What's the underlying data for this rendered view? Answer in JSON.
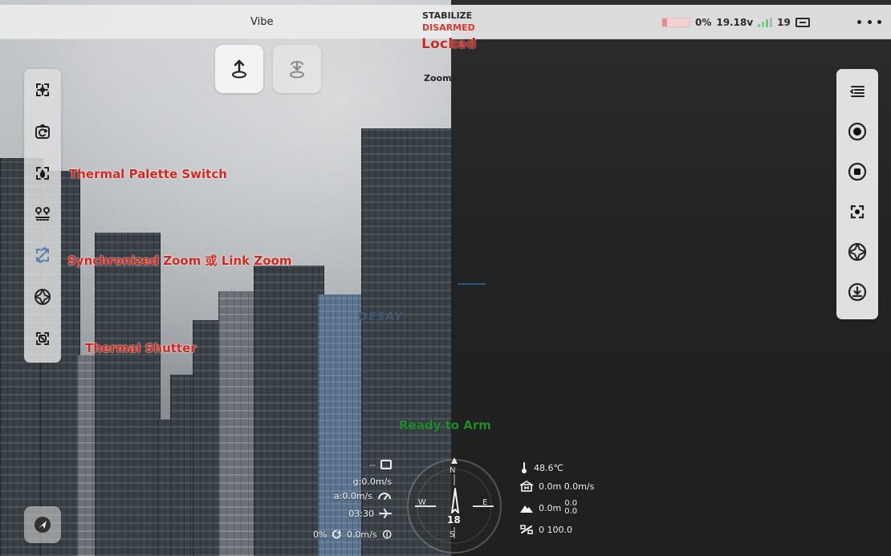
{
  "header": {
    "app_title": "Vibe",
    "flight_mode": "STABILIZE",
    "arm_status": "DISARMED",
    "lock_status": "Locked",
    "zoom": "ZoomX1.0",
    "battery_percent": "0%",
    "voltage": "19.18v",
    "satellites": "19"
  },
  "annotations": {
    "thermal_palette_switch": "Thermal Palette Switch",
    "synchronized_zoom": "Synchronized Zoom 或 Link Zoom",
    "thermal_shutter": "Thermal Shutter"
  },
  "camera": {
    "building_sign": "DESAY"
  },
  "status": {
    "ready_to_arm": "Ready to Arm"
  },
  "telemetry": {
    "left": {
      "top_value": "--",
      "ground_speed": "g:0.0m/s",
      "air_speed": "a:0.0m/s",
      "flight_time": "03:30",
      "percent": "0%",
      "vertical_speed": "0.0m/s"
    },
    "compass": {
      "north": "N",
      "south": "S",
      "east": "E",
      "west": "W",
      "heading_number": "18"
    },
    "right": {
      "temperature": "48.6℃",
      "home_distance_speed": "0.0m 0.0m/s",
      "altitude_main": "0.0m",
      "altitude_top": "0.0",
      "altitude_bottom": "0.0",
      "signal": "0 100.0"
    }
  },
  "icons": {
    "top_actions": [
      "takeoff-icon",
      "return-home-icon"
    ],
    "left_toolbar": [
      "gimbal-center-icon",
      "camera-switch-icon",
      "thermal-palette-icon",
      "route-icon",
      "link-zoom-icon",
      "aperture-icon",
      "thermal-shutter-icon"
    ],
    "right_toolbar": [
      "menu-icon",
      "record-icon",
      "stop-icon",
      "focus-target-icon",
      "aperture-icon",
      "download-icon"
    ]
  }
}
